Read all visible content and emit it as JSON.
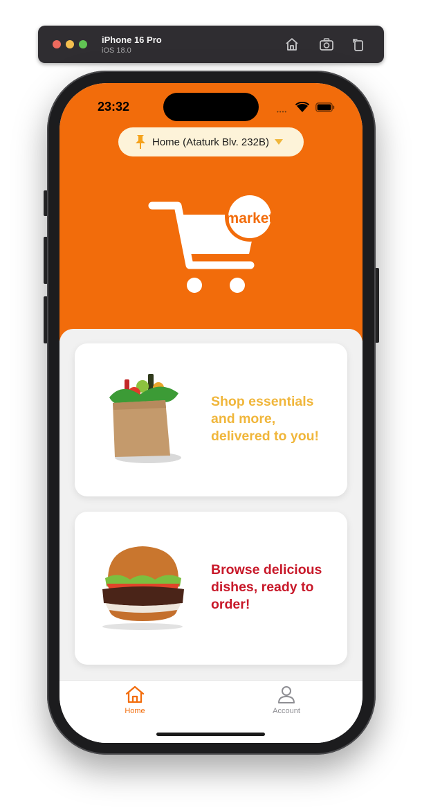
{
  "simulator": {
    "device": "iPhone 16 Pro",
    "os": "iOS 18.0",
    "buttons": [
      "home-icon",
      "screenshot-icon",
      "rotate-icon"
    ]
  },
  "status_bar": {
    "time": "23:32",
    "icons": [
      "cellular-icon",
      "wifi-icon",
      "battery-icon"
    ]
  },
  "address": {
    "label": "Home (Ataturk Blv. 232B)",
    "icon": "pin-icon"
  },
  "logo": {
    "badge_text": "market"
  },
  "cards": [
    {
      "text": "Shop essentials and more, delivered to you!",
      "image": "grocery-bag-image",
      "color": "#f0b63b"
    },
    {
      "text": "Browse delicious dishes, ready to order!",
      "image": "burger-image",
      "color": "#c8192a"
    }
  ],
  "tabs": [
    {
      "label": "Home",
      "icon": "home-icon",
      "active": true
    },
    {
      "label": "Account",
      "icon": "account-icon",
      "active": false
    }
  ],
  "colors": {
    "brand": "#f26c0b",
    "pill_bg": "#fdf3d9",
    "card1_text": "#f0b63b",
    "card2_text": "#c8192a"
  }
}
